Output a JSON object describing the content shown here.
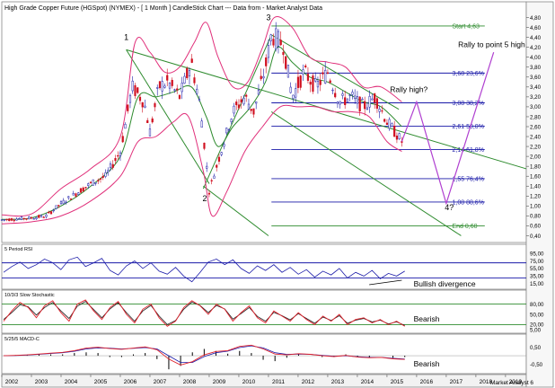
{
  "title": "High Grade Copper Future (HGSpot) (NYMEX) - [ 1 Month ] CandleStick Chart --- Data from - Market Analyst Data",
  "watermark": "Market Analyst 6",
  "colors": {
    "bollinger": "#e0307a",
    "fib": "#1a1aa8",
    "trend": "#2e8b2e",
    "projection": "#b040d0",
    "candle_up": "#1a1aa8",
    "candle_down": "#d01020",
    "rsi": "#1a1aa8",
    "stoch_k": "#e0202a",
    "stoch_d": "#202020",
    "macd": "#e0202a",
    "signal": "#1a1aa8"
  },
  "chart_data": [
    {
      "type": "candlestick",
      "panel": "price",
      "ylim": [
        0.3,
        4.9
      ],
      "yticks": [
        "4,80",
        "4,60",
        "4,40",
        "4,20",
        "4,00",
        "3,80",
        "3,60",
        "3,40",
        "3,20",
        "3,00",
        "2,80",
        "2,60",
        "2,40",
        "2,20",
        "2,00",
        "1,80",
        "1,60",
        "1,40",
        "1,20",
        "1,00",
        "0,80",
        "0,60",
        "0,40"
      ],
      "xlim": [
        2002.0,
        2019.7
      ],
      "series": [
        {
          "name": "Price",
          "points": [
            [
              2002.0,
              0.72
            ],
            [
              2002.5,
              0.74
            ],
            [
              2003.0,
              0.76
            ],
            [
              2003.5,
              0.8
            ],
            [
              2004.0,
              1.05
            ],
            [
              2004.5,
              1.25
            ],
            [
              2005.0,
              1.45
            ],
            [
              2005.5,
              1.6
            ],
            [
              2006.0,
              2.1
            ],
            [
              2006.4,
              3.4
            ],
            [
              2006.8,
              3.1
            ],
            [
              2007.0,
              2.5
            ],
            [
              2007.3,
              3.4
            ],
            [
              2007.6,
              3.5
            ],
            [
              2008.0,
              3.2
            ],
            [
              2008.4,
              3.9
            ],
            [
              2008.7,
              3.0
            ],
            [
              2009.0,
              1.3
            ],
            [
              2009.4,
              2.1
            ],
            [
              2009.8,
              2.9
            ],
            [
              2010.2,
              3.2
            ],
            [
              2010.5,
              2.9
            ],
            [
              2010.9,
              3.8
            ],
            [
              2011.1,
              4.45
            ],
            [
              2011.5,
              4.25
            ],
            [
              2011.8,
              3.2
            ],
            [
              2012.2,
              3.7
            ],
            [
              2012.6,
              3.4
            ],
            [
              2013.0,
              3.7
            ],
            [
              2013.4,
              3.1
            ],
            [
              2013.8,
              3.2
            ],
            [
              2014.2,
              3.0
            ],
            [
              2014.6,
              3.2
            ],
            [
              2015.0,
              2.7
            ],
            [
              2015.5,
              2.3
            ]
          ]
        },
        {
          "name": "Upper band",
          "points": [
            [
              2002.0,
              0.82
            ],
            [
              2003.0,
              0.84
            ],
            [
              2004.0,
              1.35
            ],
            [
              2005.0,
              1.75
            ],
            [
              2006.0,
              2.4
            ],
            [
              2006.5,
              4.3
            ],
            [
              2007.0,
              4.1
            ],
            [
              2007.5,
              3.7
            ],
            [
              2008.0,
              3.8
            ],
            [
              2008.5,
              4.3
            ],
            [
              2008.9,
              4.7
            ],
            [
              2009.3,
              4.0
            ],
            [
              2009.8,
              3.4
            ],
            [
              2010.3,
              3.5
            ],
            [
              2010.8,
              4.2
            ],
            [
              2011.2,
              4.8
            ],
            [
              2011.8,
              4.6
            ],
            [
              2012.4,
              4.0
            ],
            [
              2013.0,
              3.9
            ],
            [
              2013.6,
              3.8
            ],
            [
              2014.2,
              3.4
            ],
            [
              2014.8,
              3.4
            ],
            [
              2015.5,
              3.1
            ]
          ]
        },
        {
          "name": "Lower band",
          "points": [
            [
              2002.0,
              0.64
            ],
            [
              2003.0,
              0.68
            ],
            [
              2004.0,
              0.8
            ],
            [
              2005.0,
              1.1
            ],
            [
              2006.0,
              1.6
            ],
            [
              2006.6,
              2.3
            ],
            [
              2007.2,
              2.4
            ],
            [
              2007.8,
              2.7
            ],
            [
              2008.3,
              2.8
            ],
            [
              2008.8,
              1.7
            ],
            [
              2009.1,
              0.8
            ],
            [
              2009.6,
              1.3
            ],
            [
              2010.2,
              2.1
            ],
            [
              2010.8,
              2.6
            ],
            [
              2011.4,
              3.0
            ],
            [
              2012.0,
              3.0
            ],
            [
              2012.6,
              3.0
            ],
            [
              2013.2,
              2.9
            ],
            [
              2013.8,
              2.9
            ],
            [
              2014.4,
              2.8
            ],
            [
              2015.0,
              2.3
            ],
            [
              2015.5,
              2.1
            ]
          ]
        },
        {
          "name": "Middle band",
          "points": [
            [
              2002.0,
              0.73
            ],
            [
              2003.0,
              0.76
            ],
            [
              2004.0,
              1.0
            ],
            [
              2005.0,
              1.4
            ],
            [
              2006.0,
              2.0
            ],
            [
              2006.6,
              3.2
            ],
            [
              2007.2,
              3.2
            ],
            [
              2007.8,
              3.3
            ],
            [
              2008.4,
              3.4
            ],
            [
              2008.9,
              2.8
            ],
            [
              2009.3,
              2.2
            ],
            [
              2009.8,
              2.6
            ],
            [
              2010.4,
              3.0
            ],
            [
              2010.9,
              3.5
            ],
            [
              2011.3,
              4.2
            ],
            [
              2011.8,
              3.9
            ],
            [
              2012.4,
              3.6
            ],
            [
              2013.0,
              3.5
            ],
            [
              2013.6,
              3.3
            ],
            [
              2014.2,
              3.1
            ],
            [
              2014.8,
              3.0
            ],
            [
              2015.5,
              2.6
            ]
          ]
        }
      ],
      "fib_levels": [
        {
          "value": 4.63,
          "label": "Start 4,63"
        },
        {
          "value": 3.68,
          "label": "3,68 23,6%"
        },
        {
          "value": 3.08,
          "label": "3,08 38,2%"
        },
        {
          "value": 2.61,
          "label": "2,61 50,0%"
        },
        {
          "value": 2.14,
          "label": "2,14 61,8%"
        },
        {
          "value": 1.55,
          "label": "1,55 76,4%"
        },
        {
          "value": 1.08,
          "label": "1,08 88,6%"
        },
        {
          "value": 0.6,
          "label": "End 0,60"
        }
      ],
      "trendlines": [
        {
          "from": [
            2006.2,
            4.15
          ],
          "to": [
            2019.7,
            1.75
          ]
        },
        {
          "from": [
            2008.8,
            1.35
          ],
          "to": [
            2011.1,
            4.45
          ]
        },
        {
          "from": [
            2006.2,
            4.15
          ],
          "to": [
            2009.0,
            1.45
          ]
        },
        {
          "from": [
            2011.1,
            4.45
          ],
          "to": [
            2015.4,
            2.95
          ]
        },
        {
          "from": [
            2008.8,
            1.4
          ],
          "to": [
            2011.0,
            0.4
          ]
        },
        {
          "from": [
            2011.1,
            2.9
          ],
          "to": [
            2017.5,
            0.4
          ]
        }
      ],
      "projection": [
        [
          2015.5,
          2.3
        ],
        [
          2016.0,
          3.1
        ],
        [
          2017.0,
          1.05
        ],
        [
          2018.6,
          4.1
        ]
      ],
      "annotations": [
        {
          "text": "1",
          "x": 2006.2,
          "y": 4.35
        },
        {
          "text": "2",
          "x": 2008.85,
          "y": 1.1
        },
        {
          "text": "3",
          "x": 2011.0,
          "y": 4.75
        },
        {
          "text": "4?",
          "x": 2017.1,
          "y": 0.92
        },
        {
          "text": "Rally to point 5 high",
          "x": 2017.4,
          "y": 4.2
        },
        {
          "text": "Rally high?",
          "x": 2015.1,
          "y": 3.3
        }
      ]
    },
    {
      "type": "line",
      "panel": "rsi",
      "title": "5 Period RSI",
      "ylim": [
        5,
        100
      ],
      "yticks": [
        "95,00",
        "75,00",
        "55,00",
        "35,00",
        "15,00"
      ],
      "levels": [
        70,
        30
      ],
      "series": [
        {
          "name": "RSI",
          "values": [
            45,
            60,
            72,
            55,
            65,
            80,
            70,
            52,
            78,
            85,
            60,
            70,
            82,
            50,
            38,
            62,
            75,
            55,
            70,
            48,
            40,
            58,
            35,
            20,
            45,
            72,
            80,
            65,
            78,
            55,
            42,
            62,
            50,
            65,
            45,
            58,
            40,
            52,
            32,
            48,
            38,
            55,
            30,
            45,
            35,
            50,
            28,
            42,
            35,
            48
          ]
        }
      ],
      "annotation": "Bullish divergence"
    },
    {
      "type": "line",
      "panel": "stochastic",
      "title": "10/3/3 Slow Stochastic",
      "ylim": [
        0,
        100
      ],
      "yticks": [
        "80,00",
        "50,00",
        "20,00",
        "5,00"
      ],
      "levels": [
        80,
        20
      ],
      "series": [
        {
          "name": "%K",
          "values": [
            30,
            60,
            85,
            70,
            40,
            75,
            90,
            55,
            30,
            80,
            92,
            60,
            35,
            70,
            88,
            50,
            25,
            65,
            80,
            40,
            15,
            30,
            70,
            90,
            75,
            50,
            80,
            65,
            30,
            55,
            75,
            40,
            25,
            60,
            45,
            30,
            55,
            35,
            20,
            45,
            30,
            50,
            20,
            35,
            40,
            25,
            35,
            20,
            30,
            15
          ]
        },
        {
          "name": "%D",
          "values": [
            35,
            55,
            78,
            72,
            48,
            70,
            85,
            60,
            38,
            74,
            88,
            64,
            40,
            66,
            84,
            55,
            30,
            60,
            76,
            45,
            20,
            32,
            65,
            86,
            76,
            55,
            76,
            66,
            36,
            52,
            70,
            44,
            30,
            56,
            46,
            34,
            52,
            38,
            24,
            42,
            32,
            46,
            24,
            33,
            38,
            28,
            33,
            22,
            28,
            18
          ]
        }
      ],
      "annotation": "Bearish"
    },
    {
      "type": "line",
      "panel": "macd",
      "title": "5/25/5 MACD-C",
      "ylim": [
        -0.95,
        0.85
      ],
      "yticks": [
        "0,50",
        "-0,50"
      ],
      "series": [
        {
          "name": "MACD",
          "values": [
            0.0,
            0.02,
            0.05,
            0.1,
            0.15,
            0.2,
            0.3,
            0.45,
            0.5,
            0.42,
            0.38,
            0.45,
            0.52,
            0.35,
            -0.2,
            -0.55,
            -0.35,
            0.05,
            0.25,
            0.3,
            0.55,
            0.62,
            0.4,
            0.1,
            0.05,
            0.12,
            0.08,
            0.0,
            -0.05,
            0.02,
            -0.08,
            -0.12,
            -0.1,
            -0.18,
            -0.22
          ]
        },
        {
          "name": "Signal",
          "values": [
            0.0,
            0.01,
            0.04,
            0.08,
            0.13,
            0.18,
            0.26,
            0.4,
            0.46,
            0.44,
            0.4,
            0.43,
            0.48,
            0.4,
            0.0,
            -0.4,
            -0.4,
            -0.05,
            0.18,
            0.27,
            0.48,
            0.58,
            0.46,
            0.18,
            0.08,
            0.1,
            0.08,
            0.02,
            -0.03,
            0.0,
            -0.06,
            -0.1,
            -0.1,
            -0.15,
            -0.2
          ]
        }
      ],
      "annotation": "Bearish"
    }
  ],
  "x_axis": {
    "ticks": [
      "2002",
      "2003",
      "2004",
      "2005",
      "2006",
      "2007",
      "2008",
      "2009",
      "2010",
      "2011",
      "2012",
      "2013",
      "2014",
      "2015",
      "2016",
      "2017",
      "2018",
      "2019"
    ]
  }
}
